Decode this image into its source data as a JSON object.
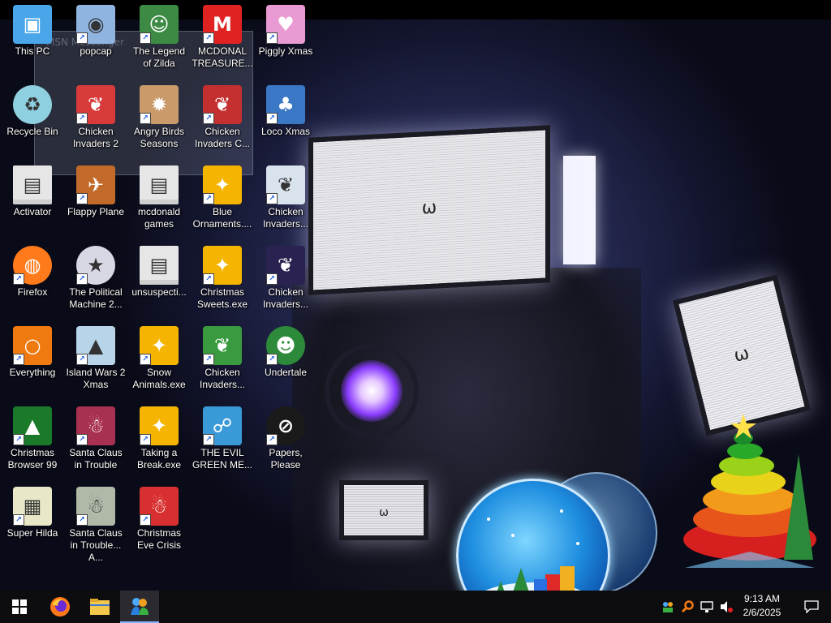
{
  "desktop": {
    "icons": [
      {
        "label": "This PC",
        "icon": "computer-icon",
        "color": "#4aa6e8"
      },
      {
        "label": "popcap",
        "icon": "popcap-icon",
        "color": "#8fb4e0"
      },
      {
        "label": "The Legend of Zilda",
        "icon": "zilda-icon",
        "color": "#3d8a45"
      },
      {
        "label": "MCDONAL TREASURE...",
        "icon": "mcdonalds-icon",
        "color": "#e02222"
      },
      {
        "label": "Piggly Xmas",
        "icon": "pig-icon",
        "color": "#e99ad2"
      },
      {
        "label": "Recycle Bin",
        "icon": "recycle-bin-icon",
        "color": "#8fd0e0"
      },
      {
        "label": "Chicken Invaders 2",
        "icon": "chicken-icon",
        "color": "#d83a3a"
      },
      {
        "label": "Angry Birds Seasons",
        "icon": "angry-birds-icon",
        "color": "#c99a6a"
      },
      {
        "label": "Chicken Invaders C...",
        "icon": "chicken-icon",
        "color": "#c43030"
      },
      {
        "label": "Loco Xmas",
        "icon": "bear-icon",
        "color": "#3a78c6"
      },
      {
        "label": "Activator",
        "icon": "folder-icon",
        "color": "#e6e6e6"
      },
      {
        "label": "Flappy Plane",
        "icon": "plane-icon",
        "color": "#c26a2a"
      },
      {
        "label": "mcdonald games",
        "icon": "folder-icon",
        "color": "#e6e6e6"
      },
      {
        "label": "Blue Ornaments....",
        "icon": "gift-icon",
        "color": "#f5b400"
      },
      {
        "label": "Chicken Invaders...",
        "icon": "chicken-icon",
        "color": "#d9e3ee"
      },
      {
        "label": "Firefox",
        "icon": "firefox-icon",
        "color": "#ff7a1a"
      },
      {
        "label": "The Political Machine 2...",
        "icon": "political-icon",
        "color": "#d8d8e4"
      },
      {
        "label": "unsuspecti...",
        "icon": "folder-icon",
        "color": "#e6e6e6"
      },
      {
        "label": "Christmas Sweets.exe",
        "icon": "gift-icon",
        "color": "#f5b400"
      },
      {
        "label": "Chicken Invaders...",
        "icon": "chicken-icon",
        "color": "#2a2250"
      },
      {
        "label": "Everything",
        "icon": "search-icon",
        "color": "#f07a10"
      },
      {
        "label": "Island Wars 2 Xmas",
        "icon": "island-icon",
        "color": "#b8d4e8"
      },
      {
        "label": "Snow Animals.exe",
        "icon": "gift-icon",
        "color": "#f5b400"
      },
      {
        "label": "Chicken Invaders...",
        "icon": "chicken-icon",
        "color": "#3a9a40"
      },
      {
        "label": "Undertale",
        "icon": "undertale-icon",
        "color": "#2c8a3a"
      },
      {
        "label": "Christmas Browser 99",
        "icon": "tree-icon",
        "color": "#1a7a2a"
      },
      {
        "label": "Santa Claus in Trouble",
        "icon": "santa-icon",
        "color": "#a83050"
      },
      {
        "label": "Taking a Break.exe",
        "icon": "gift-icon",
        "color": "#f5b400"
      },
      {
        "label": "THE EVIL GREEN ME...",
        "icon": "messenger-icon",
        "color": "#3a9ad8"
      },
      {
        "label": "Papers, Please",
        "icon": "papers-please-icon",
        "color": "#1a1a1a"
      },
      {
        "label": "Super Hilda",
        "icon": "pixel-icon",
        "color": "#e8e8c8"
      },
      {
        "label": "Santa Claus in Trouble... A...",
        "icon": "santa-icon",
        "color": "#b0b8a8"
      },
      {
        "label": "Christmas Eve Crisis",
        "icon": "santa-icon",
        "color": "#d83030"
      }
    ],
    "wallpaper": {
      "face_main": "ω",
      "face_side": "ω",
      "face_small": "ω",
      "ghost_window_title": "MSN Messenger"
    }
  },
  "taskbar": {
    "items": [
      {
        "name": "start-button",
        "icon": "windows-logo-icon"
      },
      {
        "name": "firefox-taskbar-button",
        "icon": "firefox-icon"
      },
      {
        "name": "file-explorer-taskbar-button",
        "icon": "folder-icon"
      },
      {
        "name": "messenger-taskbar-button",
        "icon": "messenger-icon",
        "active": true
      }
    ],
    "tray": {
      "time": "9:13 AM",
      "date": "2/6/2025"
    }
  },
  "colors": {
    "taskbar": "#0d0d0f",
    "accent": "#7fb2ff"
  }
}
